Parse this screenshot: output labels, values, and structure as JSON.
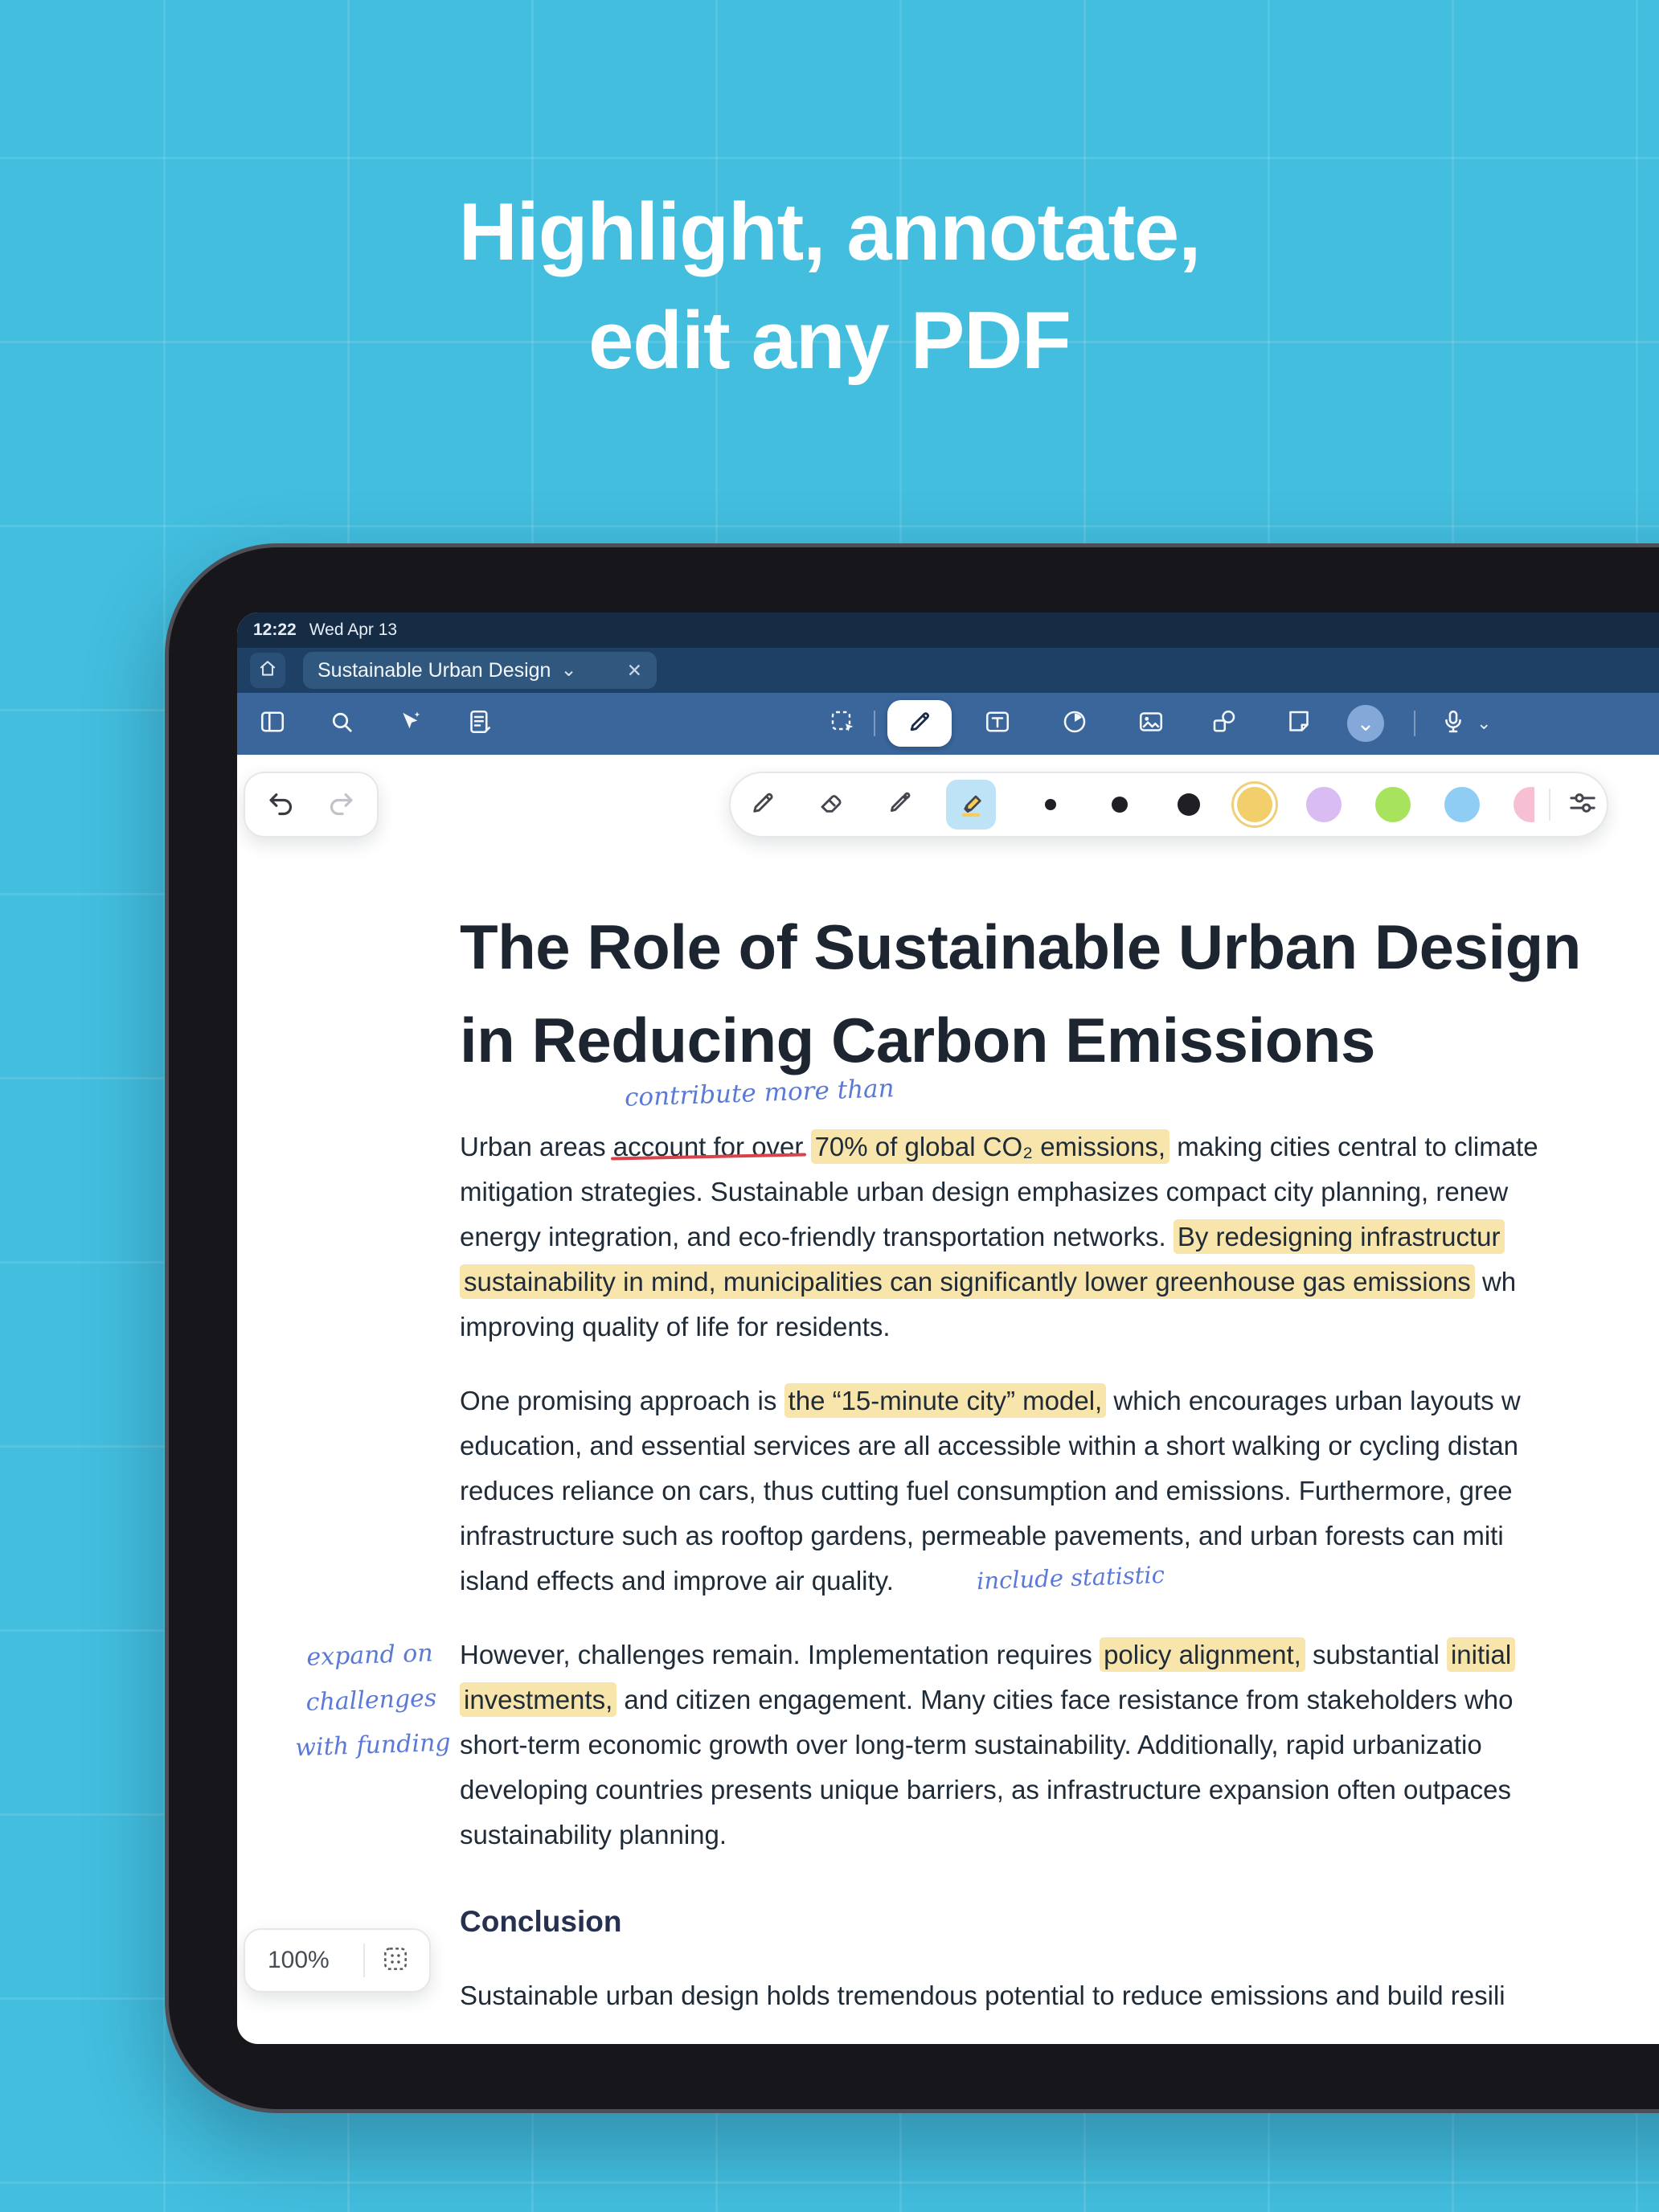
{
  "hero": {
    "heading_line1": "Highlight, annotate,",
    "heading_line2": "edit any PDF"
  },
  "device": {
    "status_bar": {
      "time": "12:22",
      "date": "Wed Apr 13"
    },
    "tab_bar": {
      "active_tab_title": "Sustainable Urban Design",
      "tab_chevron": "⌄",
      "tab_close": "✕"
    },
    "toolbar": {
      "more_chevron": "⌄",
      "voice_chevron": "⌄"
    }
  },
  "zoom_control": {
    "level": "100%"
  },
  "annotations": {
    "insertion_note": "contribute more than",
    "inline_note": "include statistic",
    "margin_note_lines": [
      "expand on",
      "challenges",
      "with funding"
    ]
  },
  "document": {
    "title_lines": [
      "The Role of Sustainable Urban Design",
      "in Reducing Carbon Emissions"
    ],
    "paragraphs": [
      [
        [
          {
            "t": "Urban areas "
          },
          {
            "t": "account for over",
            "x": true
          },
          {
            "t": " "
          },
          {
            "t": "70% of global CO₂ emissions,",
            "m": true
          },
          {
            "t": " making cities central to climate"
          }
        ],
        [
          {
            "t": "mitigation strategies. Sustainable urban design emphasizes compact city planning, renew"
          }
        ],
        [
          {
            "t": "energy integration, and eco-friendly transportation networks. "
          },
          {
            "t": "By redesigning infrastructur",
            "m": true
          }
        ],
        [
          {
            "t": "sustainability in mind, municipalities can significantly lower greenhouse gas emissions",
            "m": true
          },
          {
            "t": " wh"
          }
        ],
        [
          {
            "t": "improving quality of life for residents."
          }
        ]
      ],
      [
        [
          {
            "t": "One promising approach is "
          },
          {
            "t": "the “15-minute city” model,",
            "m": true
          },
          {
            "t": " which encourages urban layouts w"
          }
        ],
        [
          {
            "t": "education, and essential services are all accessible within a short walking or cycling distan"
          }
        ],
        [
          {
            "t": "reduces reliance on cars, thus cutting fuel consumption and emissions. Furthermore, gree"
          }
        ],
        [
          {
            "t": "infrastructure such as rooftop gardens, permeable pavements, and urban forests can miti"
          }
        ],
        [
          {
            "t": "island effects and improve air quality."
          }
        ]
      ],
      [
        [
          {
            "t": "However, challenges remain. Implementation requires "
          },
          {
            "t": "policy alignment,",
            "m": true
          },
          {
            "t": " substantial "
          },
          {
            "t": "initial",
            "m": true
          }
        ],
        [
          {
            "t": "investments,",
            "m": true
          },
          {
            "t": " and citizen engagement. Many cities face resistance from stakeholders who"
          }
        ],
        [
          {
            "t": "short-term economic growth over long-term sustainability. Additionally, rapid urbanizatio"
          }
        ],
        [
          {
            "t": "developing countries presents unique barriers, as infrastructure expansion often outpaces"
          }
        ],
        [
          {
            "t": "sustainability planning."
          }
        ]
      ]
    ],
    "conclusion_heading": "Conclusion",
    "closing_line": "Sustainable urban design holds tremendous potential to reduce emissions and build resili"
  },
  "colors": {
    "background_cyan": "#43BEDF",
    "status_bar_blue": "#152C44",
    "tab_bar_blue": "#1F4065",
    "toolbar_blue": "#3A669C",
    "highlight_yellow": "#F8E5AB",
    "annotation_blue": "#5B79D6",
    "strike_red": "#D9444A",
    "swatches": [
      "#F2CF6B",
      "#D9BCF2",
      "#A8E35D",
      "#8FCDF4",
      "#F6BFD3"
    ]
  }
}
